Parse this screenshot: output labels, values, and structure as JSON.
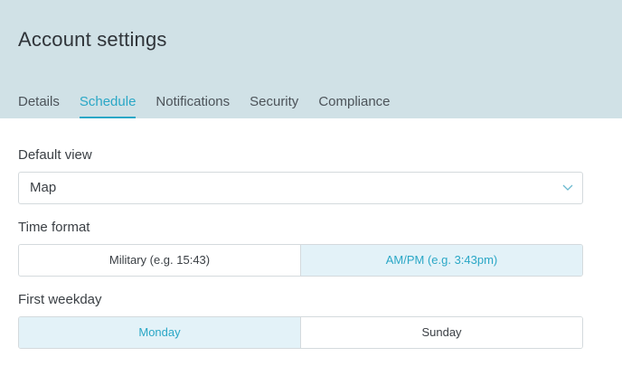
{
  "header": {
    "title": "Account settings",
    "tabs": [
      {
        "label": "Details",
        "active": false
      },
      {
        "label": "Schedule",
        "active": true
      },
      {
        "label": "Notifications",
        "active": false
      },
      {
        "label": "Security",
        "active": false
      },
      {
        "label": "Compliance",
        "active": false
      }
    ]
  },
  "form": {
    "default_view": {
      "label": "Default view",
      "value": "Map",
      "icon": "chevron-down-icon"
    },
    "time_format": {
      "label": "Time format",
      "options": [
        {
          "label": "Military (e.g. 15:43)",
          "selected": false
        },
        {
          "label": "AM/PM (e.g. 3:43pm)",
          "selected": true
        }
      ]
    },
    "first_weekday": {
      "label": "First weekday",
      "options": [
        {
          "label": "Monday",
          "selected": true
        },
        {
          "label": "Sunday",
          "selected": false
        }
      ]
    }
  },
  "colors": {
    "header_bg": "#d0e1e6",
    "accent": "#2aa7c6",
    "selected_bg": "#e3f2f8",
    "border": "#d4dadd"
  }
}
